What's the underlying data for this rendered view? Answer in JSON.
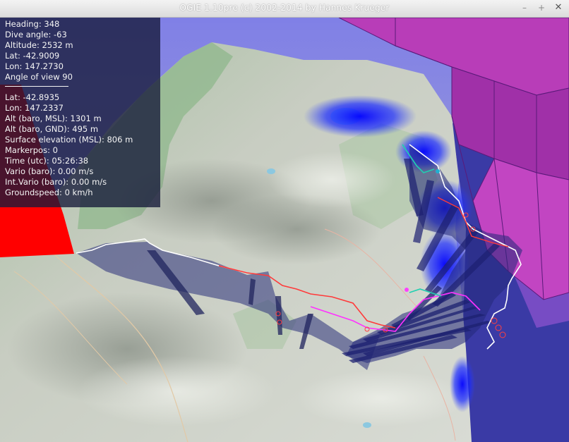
{
  "window": {
    "title": "OGIE 1.10pre (c) 2002-2014 by Hannes Krueger",
    "controls": [
      "–",
      "+",
      "✕"
    ]
  },
  "hud": {
    "camera": [
      "Heading: 348",
      "Dive angle: -63",
      "Altitude: 2532 m",
      "Lat: -42.9009",
      "Lon: 147.2730",
      "Angle of view 90"
    ],
    "separator": "——————————",
    "marker": [
      "Lat: -42.8935",
      "Lon: 147.2337",
      "Alt (baro, MSL): 1301 m",
      "Alt (baro, GND): 495 m",
      "Surface elevation (MSL): 806 m",
      "Markerpos: 0",
      "Time (utc): 05:26:38",
      "Vario (baro): 0.00 m/s",
      "Int.Vario (baro): 0.00 m/s",
      "Groundspeed: 0 km/h"
    ]
  },
  "colors": {
    "sky": "#8f8fe0",
    "airspace_magenta": "#b33cb3",
    "airspace_red": "#ff0000",
    "track_curtain": "#2a2f7a",
    "track_white": "#ffffff",
    "track_red": "#ff3030",
    "track_magenta": "#ff30ff",
    "terrain_green": "#9fc49a",
    "terrain_light": "#d8dcd2"
  }
}
